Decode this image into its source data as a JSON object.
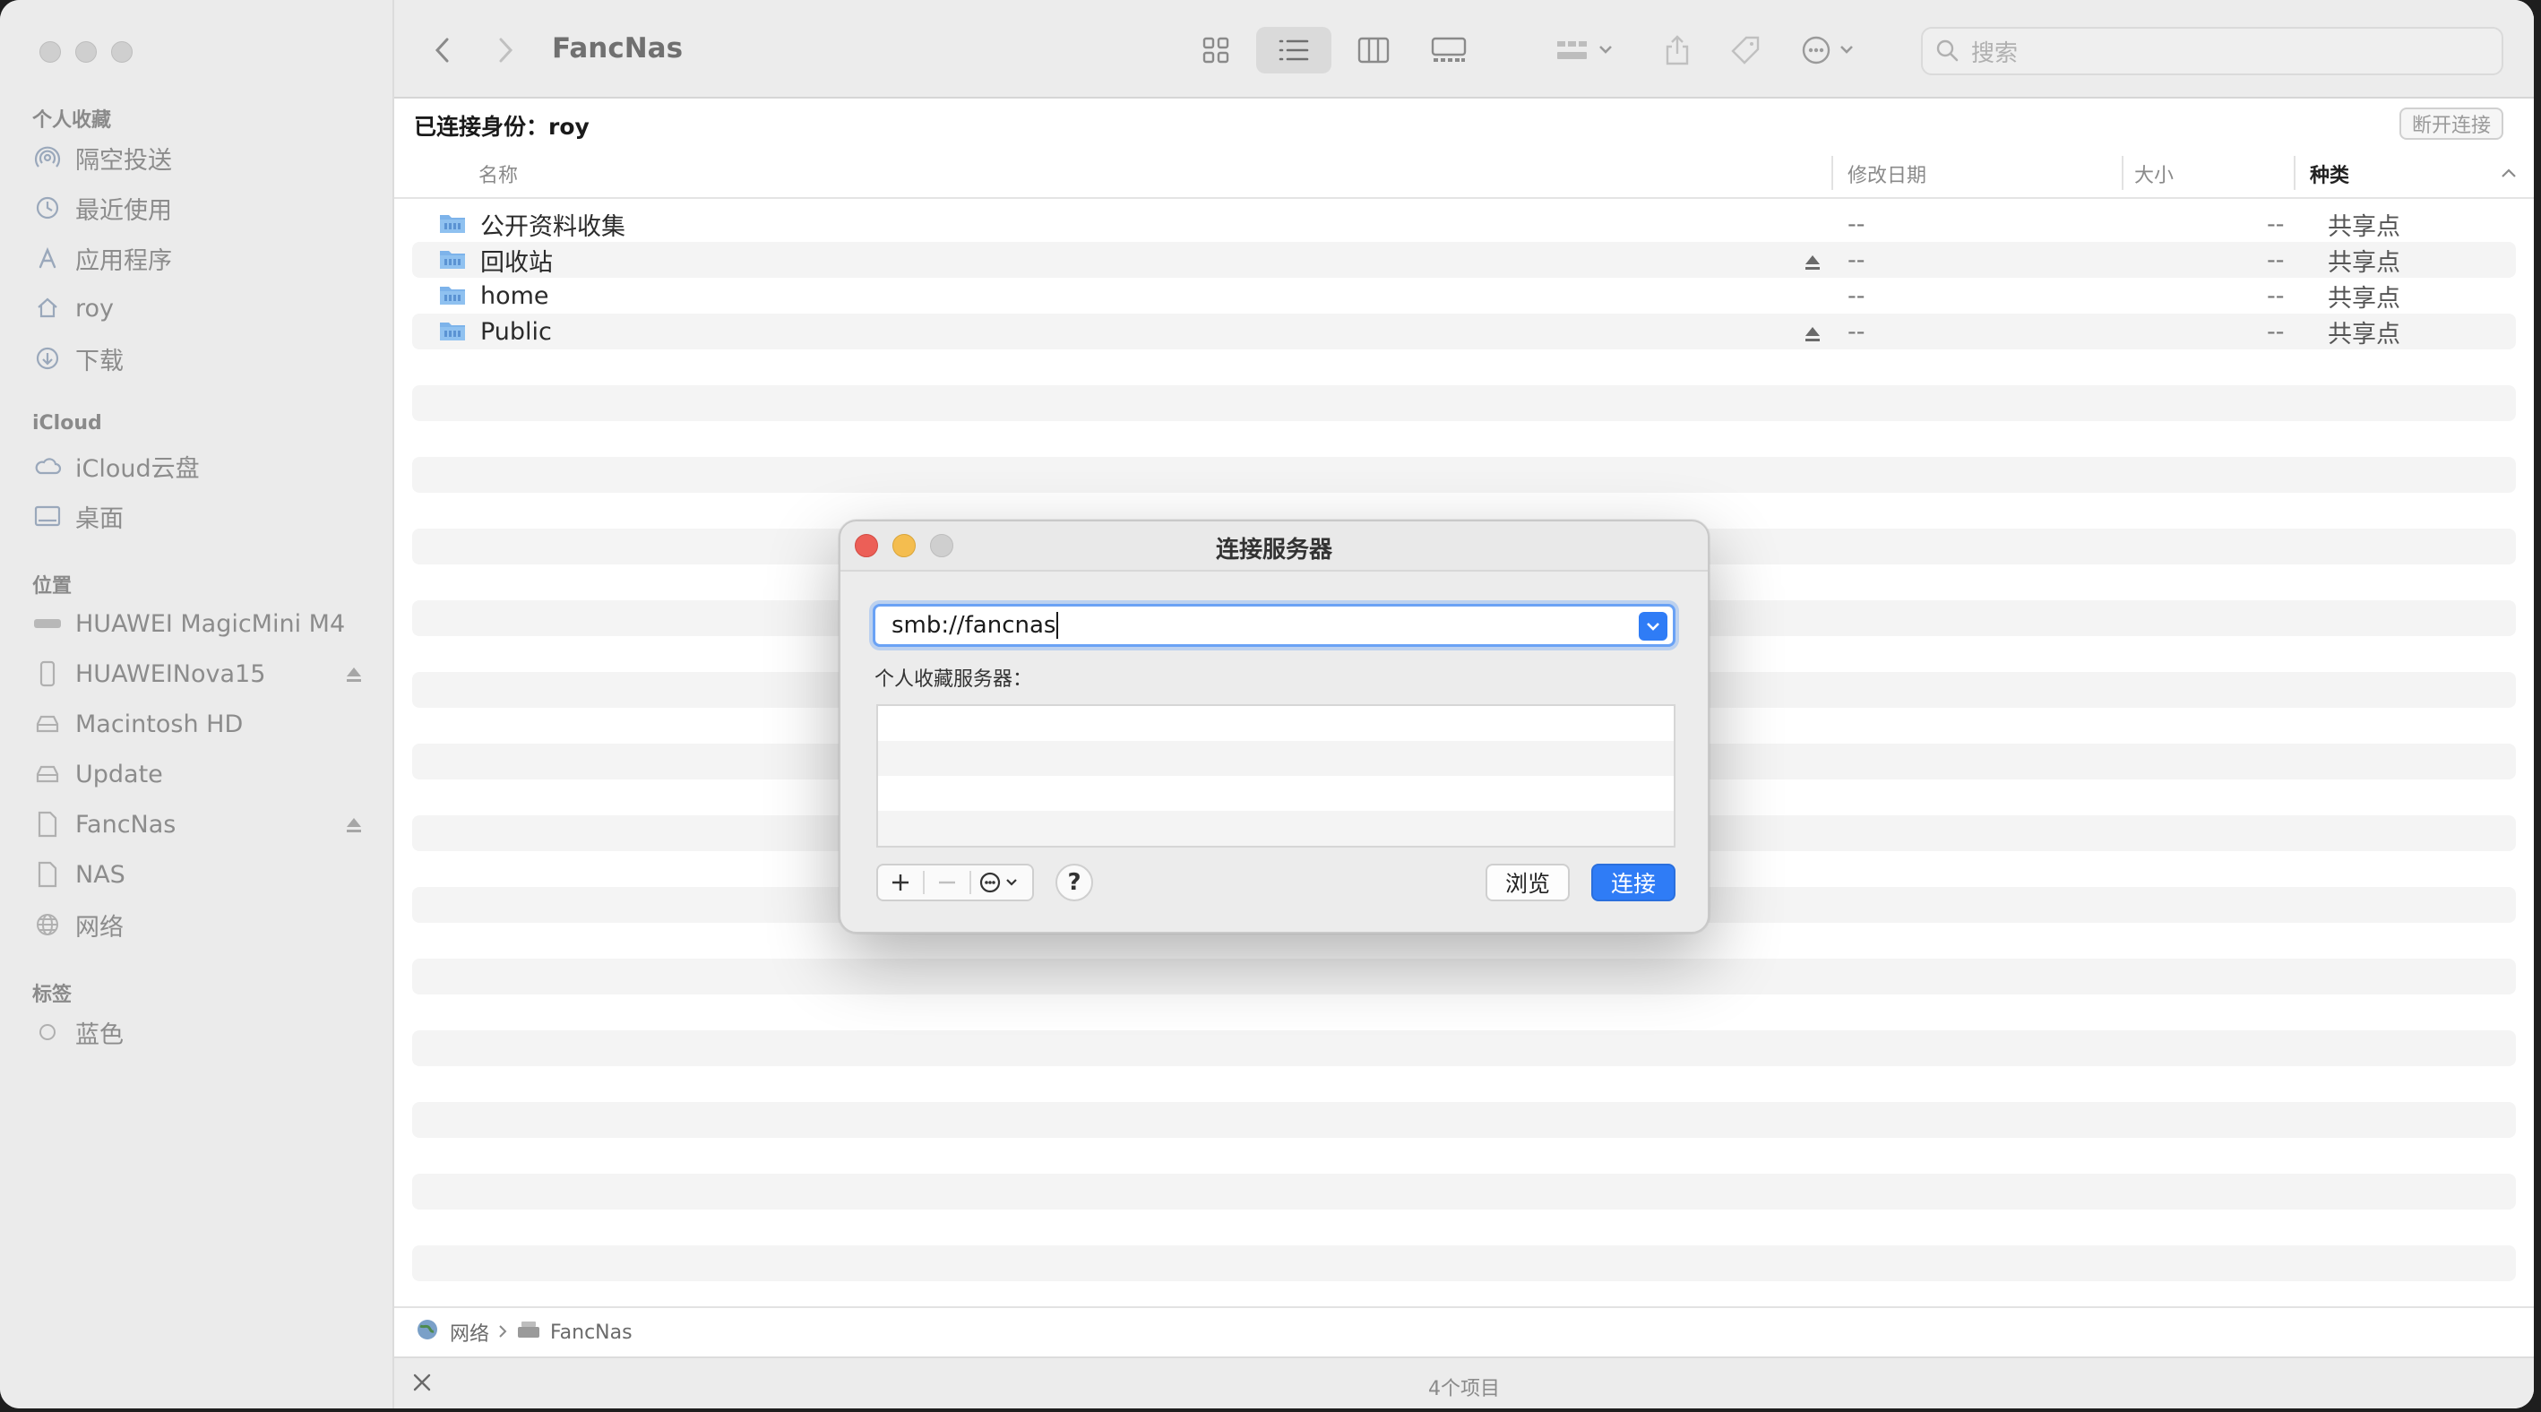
{
  "sidebar": {
    "favorites_title": "个人收藏",
    "favorites": [
      {
        "label": "隔空投送",
        "icon": "airdrop-icon"
      },
      {
        "label": "最近使用",
        "icon": "clock-icon"
      },
      {
        "label": "应用程序",
        "icon": "applications-icon"
      },
      {
        "label": "roy",
        "icon": "home-icon"
      },
      {
        "label": "下载",
        "icon": "download-icon"
      }
    ],
    "icloud_title": "iCloud",
    "icloud": [
      {
        "label": "iCloud云盘",
        "icon": "cloud-icon"
      },
      {
        "label": "桌面",
        "icon": "desktop-icon"
      }
    ],
    "locations_title": "位置",
    "locations": [
      {
        "label": "HUAWEI MagicMini M4",
        "icon": "drive-icon",
        "eject": false
      },
      {
        "label": "HUAWEINova15",
        "icon": "phone-icon",
        "eject": true
      },
      {
        "label": "Macintosh HD",
        "icon": "hard-disk-icon",
        "eject": false
      },
      {
        "label": "Update",
        "icon": "hard-disk-icon",
        "eject": false
      },
      {
        "label": "FancNas",
        "icon": "document-icon",
        "eject": true
      },
      {
        "label": "NAS",
        "icon": "document-icon",
        "eject": false
      },
      {
        "label": "网络",
        "icon": "network-globe-icon",
        "eject": false
      }
    ],
    "tags_title": "标签",
    "tags": [
      {
        "label": "蓝色",
        "icon": "tag-circle-icon"
      }
    ]
  },
  "toolbar": {
    "title": "FancNas",
    "search_placeholder": "搜索"
  },
  "identity": {
    "text": "已连接身份：roy",
    "disconnect_label": "断开连接"
  },
  "columns": {
    "name": "名称",
    "modified": "修改日期",
    "size": "大小",
    "kind": "种类"
  },
  "files": [
    {
      "name": "公开资料收集",
      "modified": "--",
      "size": "--",
      "kind": "共享点",
      "eject": false
    },
    {
      "name": "回收站",
      "modified": "--",
      "size": "--",
      "kind": "共享点",
      "eject": true
    },
    {
      "name": "home",
      "modified": "--",
      "size": "--",
      "kind": "共享点",
      "eject": false
    },
    {
      "name": "Public",
      "modified": "--",
      "size": "--",
      "kind": "共享点",
      "eject": true
    }
  ],
  "pathbar": {
    "segments": [
      "网络",
      "FancNas"
    ]
  },
  "status": {
    "item_count": "4个项目"
  },
  "dialog": {
    "title": "连接服务器",
    "address_value": "smb://fancnas",
    "favorites_label": "个人收藏服务器：",
    "browse_label": "浏览",
    "connect_label": "连接",
    "help_label": "?"
  },
  "colors": {
    "accent": "#2f7cf6",
    "close": "#ec5f57",
    "minimize": "#f4bd4f",
    "folder": "#7db3ea"
  }
}
